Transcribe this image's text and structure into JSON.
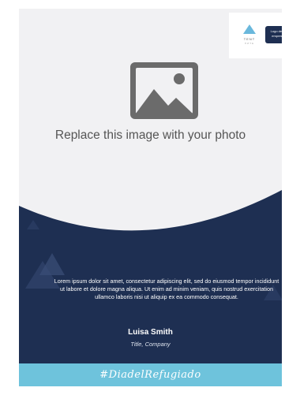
{
  "photo": {
    "caption": "Replace this image with your photo",
    "icon": "image-placeholder-icon"
  },
  "logo": {
    "name": "TENT",
    "sub": "ПИТЕ",
    "badge_text": "Logo de la empresa"
  },
  "body": {
    "text": "Lorem ipsum dolor sit amet, consectetur adipiscing elit, sed do eiusmod tempor incididunt ut labore et dolore magna aliqua. Ut enim ad minim veniam, quis nostrud exercitation ullamco laboris nisi ut aliquip ex ea commodo consequat."
  },
  "person": {
    "name": "Luisa Smith",
    "title": "Title, Company"
  },
  "hashtag": "#DiadelRefugiado",
  "colors": {
    "navy": "#1e2f52",
    "cyan": "#6ec3dc",
    "background": "#f1f1f3"
  }
}
